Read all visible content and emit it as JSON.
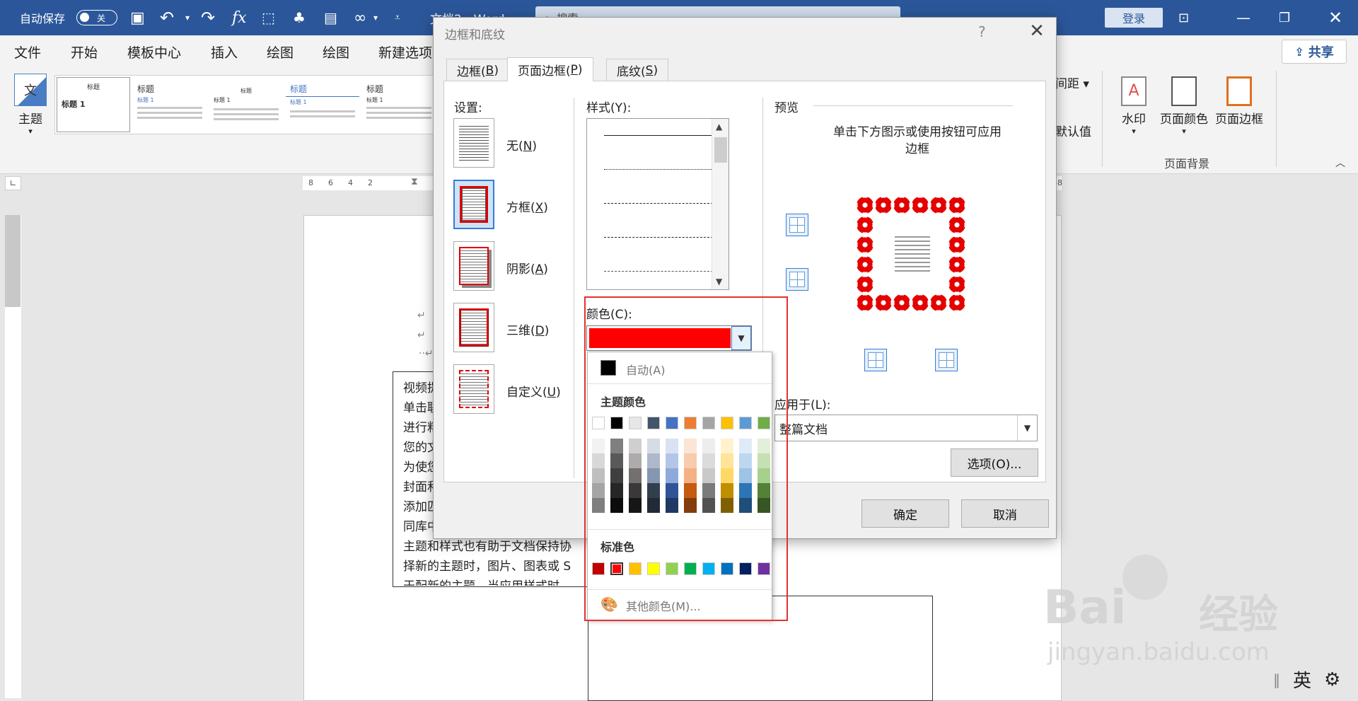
{
  "titlebar": {
    "autosave_label": "自动保存",
    "autosave_state": "关",
    "doc_title": "文档2 - Word",
    "search_placeholder": "搜索",
    "login_label": "登录"
  },
  "menu_tabs": [
    "文件",
    "开始",
    "模板中心",
    "插入",
    "绘图",
    "绘图",
    "新建选项"
  ],
  "ribbon": {
    "theme_label": "主题",
    "gallery_items": [
      {
        "title": "标题",
        "heading": "标题 1"
      },
      {
        "title": "标题",
        "heading": "标题 1"
      },
      {
        "title": "标题",
        "heading": "标题 1"
      },
      {
        "title": "标题",
        "heading": "标题 1"
      },
      {
        "title": "标题",
        "heading": "标题 1"
      }
    ],
    "spacing_label": "间距",
    "default_label": "默认值",
    "watermark_label": "水印",
    "page_color_label": "页面颜色",
    "page_border_label": "页面边框",
    "group_label": "页面背景",
    "share_label": "共享"
  },
  "ruler": {
    "h_ticks": [
      "8",
      "6",
      "4",
      "2",
      "48"
    ]
  },
  "document": {
    "textbox_lines": [
      "视频提",
      "单击联",
      "进行粘",
      "您的文",
      "为使您",
      "封面和",
      "添加匹",
      "同库中",
      "主题和样式也有助于文档保持协",
      "择新的主题时，图片、图表或 S",
      "于配新的主题。当应用样式时"
    ]
  },
  "dialog": {
    "title": "边框和底纹",
    "help": "?",
    "tabs": [
      {
        "label": "边框(",
        "key": "B",
        "end": ")"
      },
      {
        "label": "页面边框(",
        "key": "P",
        "end": ")"
      },
      {
        "label": "底纹(",
        "key": "S",
        "end": ")"
      }
    ],
    "settings_label": "设置:",
    "settings": [
      {
        "label": "无(",
        "key": "N",
        "end": ")"
      },
      {
        "label": "方框(",
        "key": "X",
        "end": ")"
      },
      {
        "label": "阴影(",
        "key": "A",
        "end": ")"
      },
      {
        "label": "三维(",
        "key": "D",
        "end": ")"
      },
      {
        "label": "自定义(",
        "key": "U",
        "end": ")"
      }
    ],
    "style_label": "样式(Y):",
    "color_label": "颜色(C):",
    "color_value": "#ff0000",
    "preview_label": "预览",
    "preview_hint_1": "单击下方图示或使用按钮可应用",
    "preview_hint_2": "边框",
    "apply_label": "应用于(L):",
    "apply_value": "整篇文档",
    "options_button": "选项(O)...",
    "ok_button": "确定",
    "cancel_button": "取消"
  },
  "color_popup": {
    "auto_label": "自动(A)",
    "theme_heading": "主题颜色",
    "theme_colors": [
      "#ffffff",
      "#000000",
      "#e7e6e6",
      "#44546a",
      "#4472c4",
      "#ed7d31",
      "#a5a5a5",
      "#ffc000",
      "#5b9bd5",
      "#70ad47"
    ],
    "shade_rows": [
      [
        "#f2f2f2",
        "#7f7f7f",
        "#d0cece",
        "#d6dce4",
        "#d9e2f3",
        "#fbe5d5",
        "#ededed",
        "#fff2cc",
        "#deebf6",
        "#e2efd9"
      ],
      [
        "#d8d8d8",
        "#595959",
        "#aeabab",
        "#adb9ca",
        "#b4c6e7",
        "#f7cbac",
        "#dbdbdb",
        "#fee599",
        "#bdd7ee",
        "#c5e0b3"
      ],
      [
        "#bfbfbf",
        "#3f3f3f",
        "#757070",
        "#8496b0",
        "#8eaadb",
        "#f4b183",
        "#c9c9c9",
        "#ffd965",
        "#9dc3e6",
        "#a8d08d"
      ],
      [
        "#a5a5a5",
        "#262626",
        "#3a3838",
        "#323f4f",
        "#2f5496",
        "#c55a11",
        "#7b7b7b",
        "#bf8f00",
        "#2e75b5",
        "#538135"
      ],
      [
        "#7f7f7f",
        "#0c0c0c",
        "#171616",
        "#222a35",
        "#1f3864",
        "#833c0b",
        "#525252",
        "#7f6000",
        "#1e4e79",
        "#375623"
      ]
    ],
    "standard_heading": "标准色",
    "standard_colors": [
      "#c00000",
      "#ff0000",
      "#ffc000",
      "#ffff00",
      "#92d050",
      "#00b050",
      "#00b0f0",
      "#0070c0",
      "#002060",
      "#7030a0"
    ],
    "more_colors": "其他颜色(M)..."
  },
  "taskbar": {
    "ime_label": "英"
  },
  "watermark": {
    "brand": "Bai",
    "brand_cn": "经验",
    "url": "jingyan.baidu.com"
  }
}
